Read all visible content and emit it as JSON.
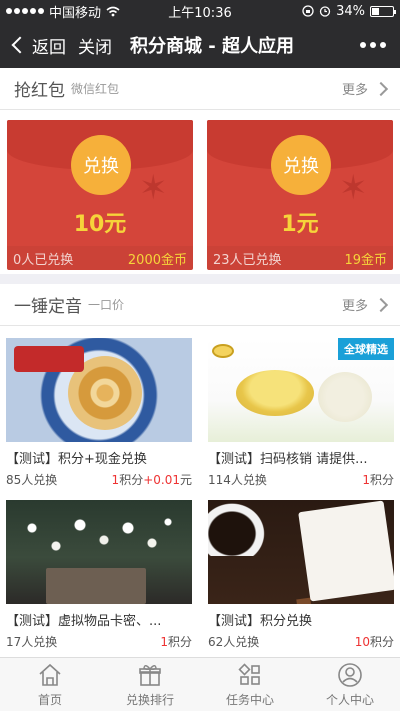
{
  "status_bar": {
    "carrier": "中国移动",
    "time": "上午10:36",
    "battery": "34%"
  },
  "nav": {
    "back_label": "返回",
    "close_label": "关闭",
    "title": "积分商城 - 超人应用"
  },
  "red_packet_section": {
    "title": "抢红包",
    "subtitle": "微信红包",
    "more_label": "更多",
    "packets": [
      {
        "coin_label": "兑换",
        "amount": "10元",
        "redeemed": "0人已兑换",
        "price": "2000金币"
      },
      {
        "coin_label": "兑换",
        "amount": "1元",
        "redeemed": "23人已兑换",
        "price": "19金币"
      }
    ]
  },
  "fixed_price_section": {
    "title": "一锤定音",
    "subtitle": "一口价",
    "more_label": "更多",
    "products": [
      {
        "name": "【测试】积分+现金兑换",
        "redeemed": "85人兑换",
        "price_num": "1",
        "price_unit": "积分",
        "price_extra": "+0.01",
        "price_extra_unit": "元"
      },
      {
        "name": "【测试】扫码核销 请提供...",
        "redeemed": "114人兑换",
        "price_num": "1",
        "price_unit": "积分",
        "badge": "全球精选"
      },
      {
        "name": "【测试】虚拟物品卡密、...",
        "redeemed": "17人兑换",
        "price_num": "1",
        "price_unit": "积分"
      },
      {
        "name": "【测试】积分兑换",
        "redeemed": "62人兑换",
        "price_num": "10",
        "price_unit": "积分"
      }
    ]
  },
  "tabbar": {
    "tabs": [
      {
        "label": "首页",
        "icon": "home-icon"
      },
      {
        "label": "兑换排行",
        "icon": "gift-icon"
      },
      {
        "label": "任务中心",
        "icon": "grid-icon"
      },
      {
        "label": "个人中心",
        "icon": "user-icon"
      }
    ]
  },
  "colors": {
    "accent_red": "#d4453a",
    "coin": "#f6b03a",
    "price_red": "#e33333",
    "gold_text": "#f6d43a"
  }
}
